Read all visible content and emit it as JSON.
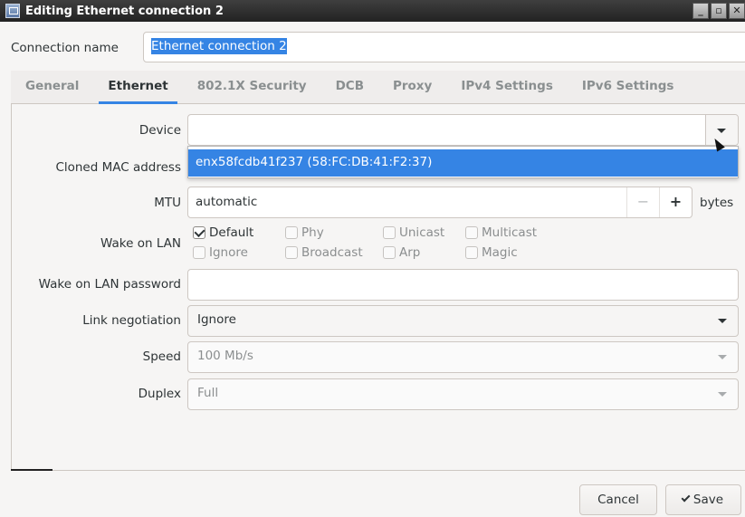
{
  "window": {
    "title": "Editing Ethernet connection 2",
    "buttons": [
      "_",
      "▫",
      "✕"
    ]
  },
  "connection": {
    "label": "Connection name",
    "value": "Ethernet connection 2"
  },
  "tabs": [
    {
      "label": "General",
      "active": false
    },
    {
      "label": "Ethernet",
      "active": true
    },
    {
      "label": "802.1X Security",
      "active": false
    },
    {
      "label": "DCB",
      "active": false
    },
    {
      "label": "Proxy",
      "active": false
    },
    {
      "label": "IPv4 Settings",
      "active": false
    },
    {
      "label": "IPv6 Settings",
      "active": false
    }
  ],
  "form": {
    "device_label": "Device",
    "device_value": "",
    "device_option": "enx58fcdb41f237 (58:FC:DB:41:F2:37)",
    "cloned_mac_label": "Cloned MAC address",
    "mtu_label": "MTU",
    "mtu_value": "automatic",
    "mtu_minus": "−",
    "mtu_plus": "+",
    "mtu_unit": "bytes",
    "wol_label": "Wake on LAN",
    "wol_options": [
      {
        "label": "Default",
        "checked": true
      },
      {
        "label": "Phy",
        "checked": false
      },
      {
        "label": "Unicast",
        "checked": false
      },
      {
        "label": "Multicast",
        "checked": false
      },
      {
        "label": "Ignore",
        "checked": false
      },
      {
        "label": "Broadcast",
        "checked": false
      },
      {
        "label": "Arp",
        "checked": false
      },
      {
        "label": "Magic",
        "checked": false
      }
    ],
    "wol_password_label": "Wake on LAN password",
    "wol_password_value": "",
    "link_neg_label": "Link negotiation",
    "link_neg_value": "Ignore",
    "speed_label": "Speed",
    "speed_value": "100 Mb/s",
    "duplex_label": "Duplex",
    "duplex_value": "Full"
  },
  "footer": {
    "cancel_label": "Cancel",
    "save_label": "Save"
  },
  "colors": {
    "accent": "#3584e4",
    "titlebar": "#2b2b2b"
  }
}
